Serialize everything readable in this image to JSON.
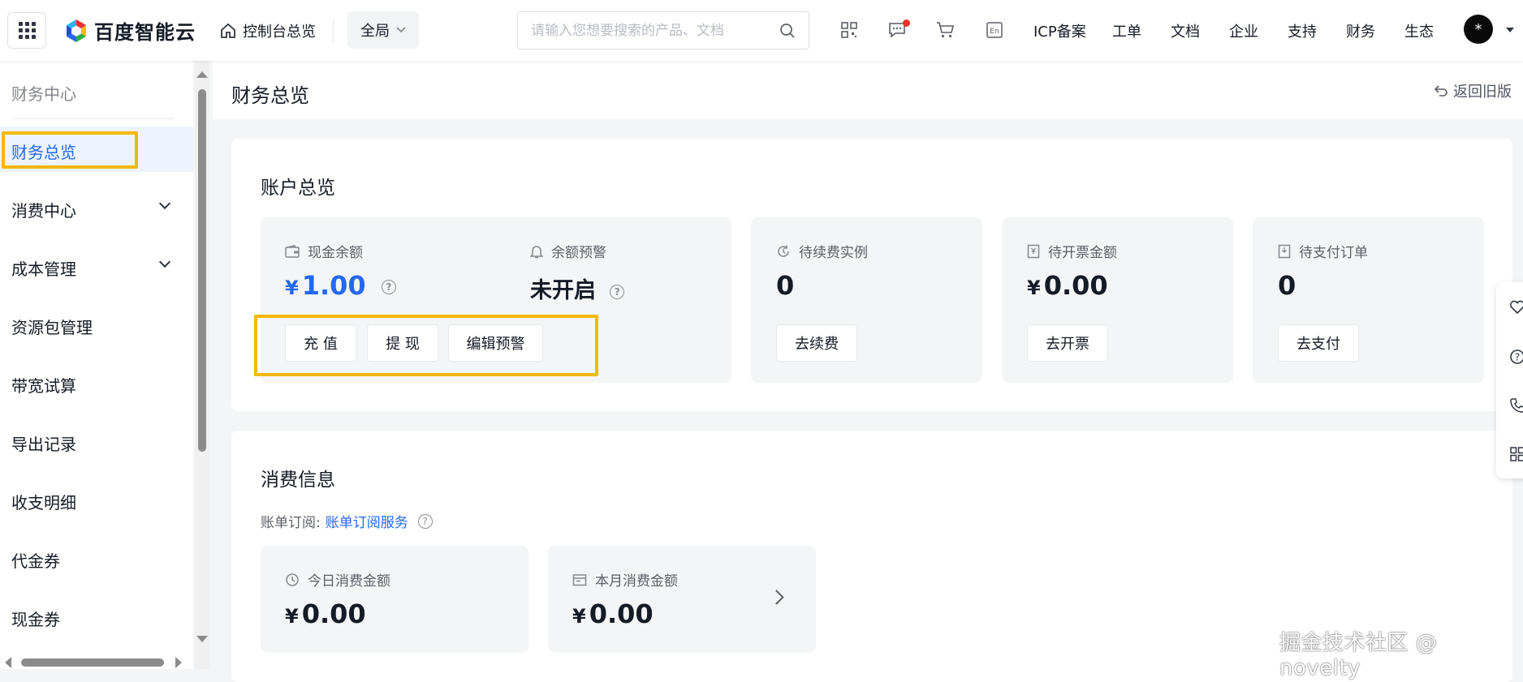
{
  "header": {
    "brand": "百度智能云",
    "home_label": "控制台总览",
    "scope_label": "全局",
    "search_placeholder": "请输入您想要搜索的产品、文档",
    "nav": [
      "ICP备案",
      "工单",
      "文档",
      "企业",
      "支持",
      "财务",
      "生态"
    ],
    "avatar_text": "*"
  },
  "sidebar": {
    "title": "财务中心",
    "items": [
      {
        "label": "财务总览",
        "active": true
      },
      {
        "label": "消费中心",
        "expandable": true
      },
      {
        "label": "成本管理",
        "expandable": true
      },
      {
        "label": "资源包管理"
      },
      {
        "label": "带宽试算"
      },
      {
        "label": "导出记录"
      },
      {
        "label": "收支明细"
      },
      {
        "label": "代金券"
      },
      {
        "label": "现金券"
      }
    ]
  },
  "page": {
    "title": "财务总览",
    "back_label": "返回旧版"
  },
  "account": {
    "title": "账户总览",
    "cash_label": "现金余额",
    "cash_currency": "¥",
    "cash_value": "1.00",
    "alert_label": "余额预警",
    "alert_value": "未开启",
    "btn_recharge": "充 值",
    "btn_withdraw": "提 现",
    "btn_edit_alert": "编辑预警",
    "renew_label": "待续费实例",
    "renew_value": "0",
    "renew_btn": "去续费",
    "invoice_label": "待开票金额",
    "invoice_currency": "¥",
    "invoice_value": "0.00",
    "invoice_btn": "去开票",
    "pay_label": "待支付订单",
    "pay_value": "0",
    "pay_btn": "去支付"
  },
  "consume": {
    "title": "消费信息",
    "sub_label": "账单订阅:",
    "sub_link": "账单订阅服务",
    "today_label": "今日消费金额",
    "today_currency": "¥",
    "today_value": "0.00",
    "month_label": "本月消费金额",
    "month_currency": "¥",
    "month_value": "0.00"
  },
  "watermark": "掘金技术社区 @ novelty",
  "colors": {
    "accent": "#2468f2",
    "highlight": "#f5b800",
    "notify": "#e8312a"
  }
}
